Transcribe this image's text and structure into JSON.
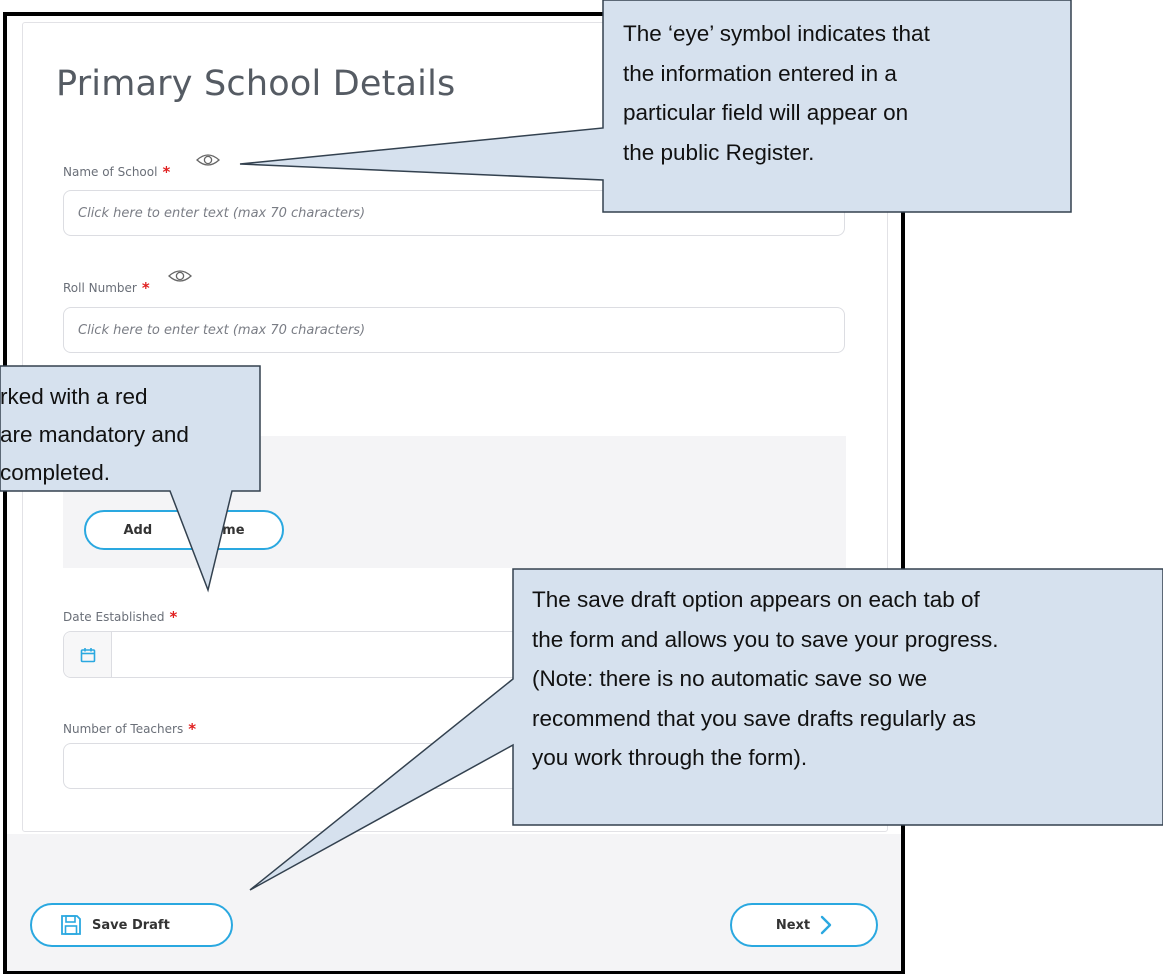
{
  "form": {
    "title": "Primary School Details",
    "fields": [
      {
        "label": "Name of School",
        "required_mark": "*",
        "placeholder": "Click here to enter text (max 70 characters)"
      },
      {
        "label": "Roll Number",
        "required_mark": "*",
        "placeholder": "Click here to enter text (max 70 characters)"
      },
      {
        "label": "Date Established",
        "required_mark": "*"
      },
      {
        "label": "Number of Teachers",
        "required_mark": "*"
      }
    ],
    "add_name_button_visible_parts": [
      "Add",
      "me"
    ]
  },
  "footer": {
    "save_draft_label": "Save Draft",
    "next_label": "Next"
  },
  "callouts": {
    "eye_symbol": [
      "The ‘eye’ symbol indicates that",
      "the information entered in a",
      "particular field will appear on",
      "the public Register."
    ],
    "mandatory": [
      "rked with a red",
      "are mandatory and",
      "completed."
    ],
    "save_draft": [
      "The save draft option appears on each tab of",
      "the form and allows you to save your progress.",
      "(Note: there is no automatic save so we",
      "recommend that you save drafts regularly as",
      "you work through the form)."
    ]
  },
  "colors": {
    "accent": "#2aa8e0",
    "required": "#e02020",
    "callout_fill": "#d6e1ee",
    "callout_border": "#33414f"
  },
  "icons": [
    "eye-icon",
    "calendar-icon",
    "save-icon",
    "chevron-right-icon"
  ]
}
